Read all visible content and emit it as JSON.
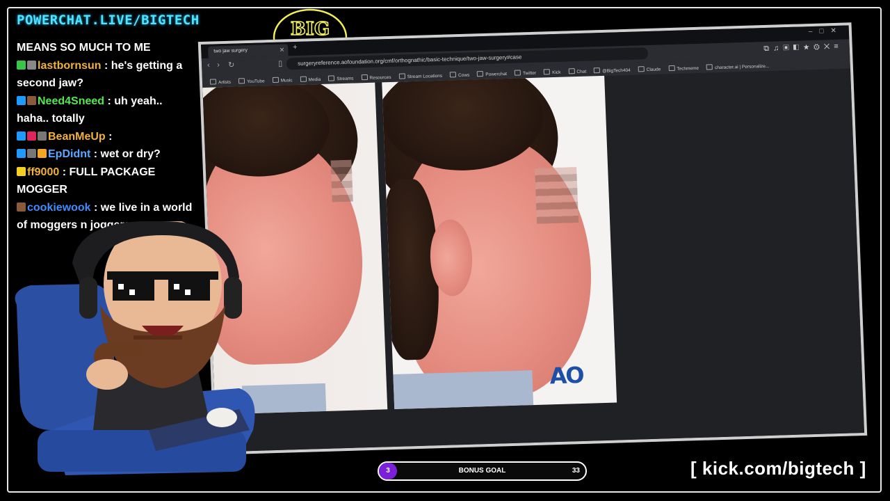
{
  "overlay": {
    "site_banner": "POWERCHAT.LIVE/BIGTECH",
    "logo_text": "BIG TECH",
    "kick_url": "[ kick.com/bigtech ]",
    "bonus_goal": {
      "level": "3",
      "label": "BONUS GOAL",
      "count": "33",
      "progress": 0.0
    }
  },
  "chat": {
    "messages": [
      {
        "user": "",
        "text": "MEANS SO MUCH TO ME",
        "user_color": "#ffffff"
      },
      {
        "user": "lastbornsun",
        "text": " : he's getting a second jaw?",
        "user_color": "#f2b13a"
      },
      {
        "user": "Need4Sneed",
        "text": " : uh yeah.. haha.. totally",
        "user_color": "#53e84f"
      },
      {
        "user": "BeanMeUp",
        "text": " : ",
        "user_color": "#f2b13a"
      },
      {
        "user": "EpDidnt",
        "text": " : wet or dry?",
        "user_color": "#5aa8ff"
      },
      {
        "user": "ff9000",
        "text": " : FULL PACKAGE MOGGER",
        "user_color": "#f2b13a"
      },
      {
        "user": "cookiewook",
        "text": " : we live in a world of moggers n joggers....",
        "user_color": "#3f8cff"
      }
    ]
  },
  "browser": {
    "tab_title": "two jaw surgery",
    "url": "surgeryreference.aofoundation.org/cmf/orthognathic/basic-technique/two-jaw-surgery#case",
    "bookmarks": [
      "Artists",
      "YouTube",
      "Music",
      "Media",
      "Streams",
      "Resources",
      "Stream Locations",
      "Cows",
      "Powerchat",
      "Twitter",
      "Kick",
      "Chat",
      "@BigTech404",
      "Claude",
      "Techmeme",
      "character.ai | Personalize..."
    ],
    "watermark": "AO"
  }
}
